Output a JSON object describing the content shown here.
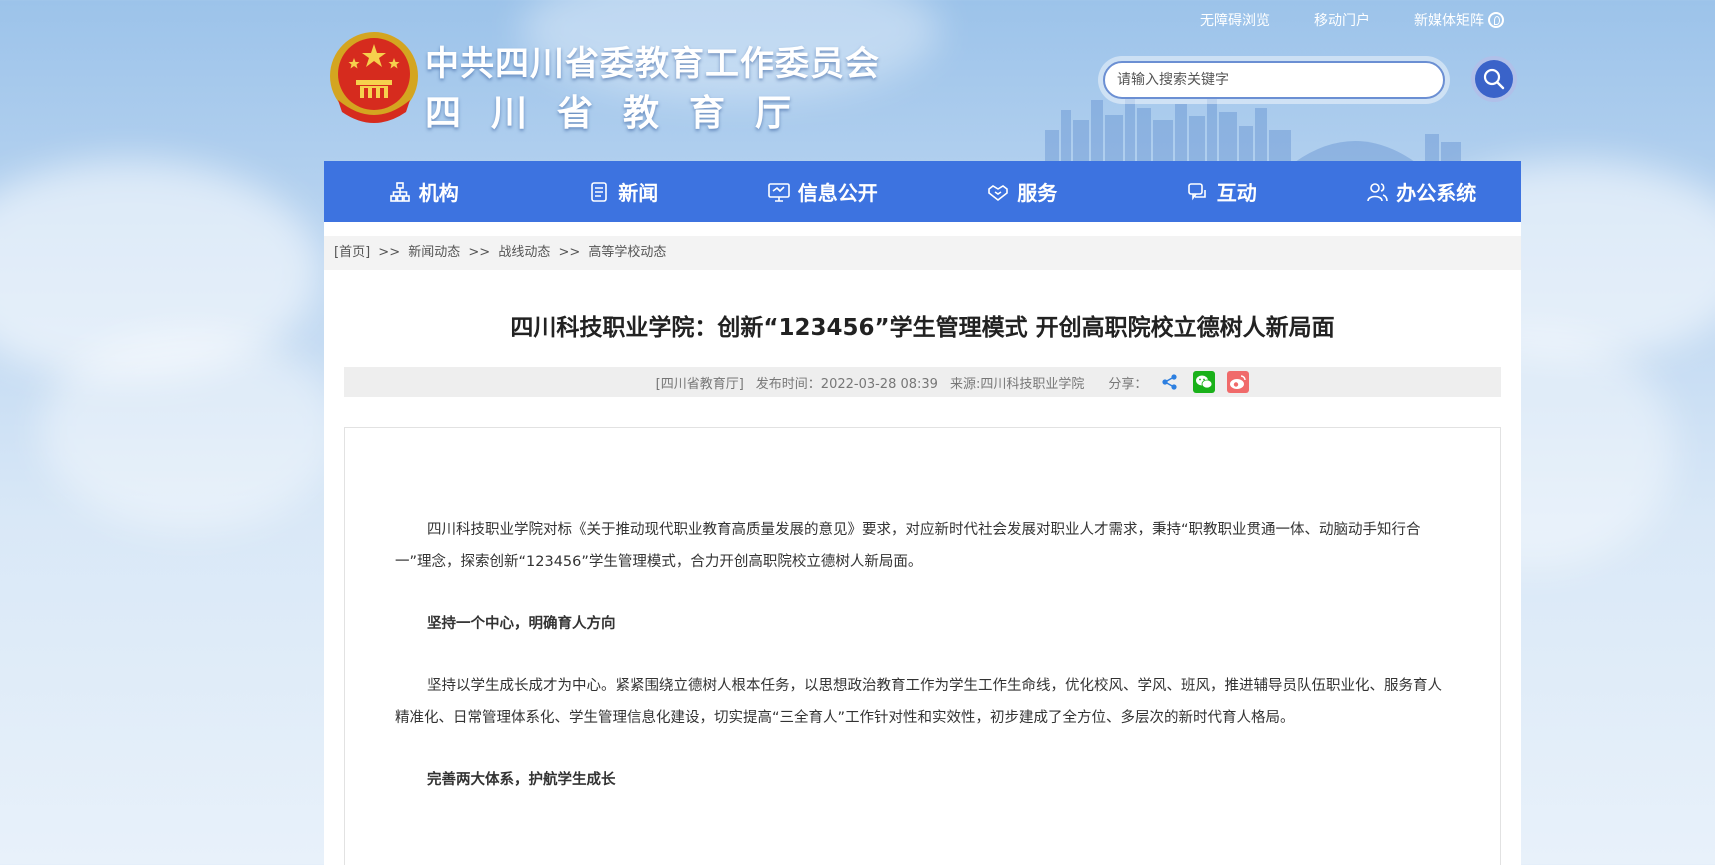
{
  "top_links": {
    "accessible": "无障碍浏览",
    "mobile": "移动门户",
    "new_media": "新媒体矩阵"
  },
  "header": {
    "title_line1": "中共四川省委教育工作委员会",
    "title_line2": "四川省教育厅"
  },
  "search": {
    "placeholder": "请输入搜索关键字"
  },
  "nav": {
    "items": [
      {
        "label": "机构",
        "icon": "org-chart-icon"
      },
      {
        "label": "新闻",
        "icon": "news-icon"
      },
      {
        "label": "信息公开",
        "icon": "monitor-icon"
      },
      {
        "label": "服务",
        "icon": "handshake-icon"
      },
      {
        "label": "互动",
        "icon": "chat-icon"
      },
      {
        "label": "办公系统",
        "icon": "user-group-icon"
      }
    ]
  },
  "breadcrumb": {
    "home": "[首页]",
    "sep": ">>",
    "level1": "新闻动态",
    "level2": "战线动态",
    "level3": "高等学校动态"
  },
  "article": {
    "title": "四川科技职业学院：创新“123456”学生管理模式 开创高职院校立德树人新局面",
    "meta": {
      "source_tag": "[四川省教育厅]",
      "publish_time": "发布时间：2022-03-28 08:39",
      "origin": "来源:四川科技职业学院",
      "share_label": "分享："
    },
    "paragraphs": [
      "四川科技职业学院对标《关于推动现代职业教育高质量发展的意见》要求，对应新时代社会发展对职业人才需求，秉持“职教职业贯通一体、动脑动手知行合一”理念，探索创新“123456”学生管理模式，合力开创高职院校立德树人新局面。",
      "坚持一个中心，明确育人方向",
      "坚持以学生成长成才为中心。紧紧围绕立德树人根本任务，以思想政治教育工作为学生工作生命线，优化校风、学风、班风，推进辅导员队伍职业化、服务育人精准化、日常管理体系化、学生管理信息化建设，切实提高“三全育人”工作针对性和实效性，初步建成了全方位、多层次的新时代育人格局。",
      "完善两大体系，护航学生成长"
    ]
  },
  "colors": {
    "nav_bg": "#3d73e0",
    "search_btn": "#3a63c9",
    "wechat": "#1ab11a",
    "weibo": "#f06a6a"
  }
}
